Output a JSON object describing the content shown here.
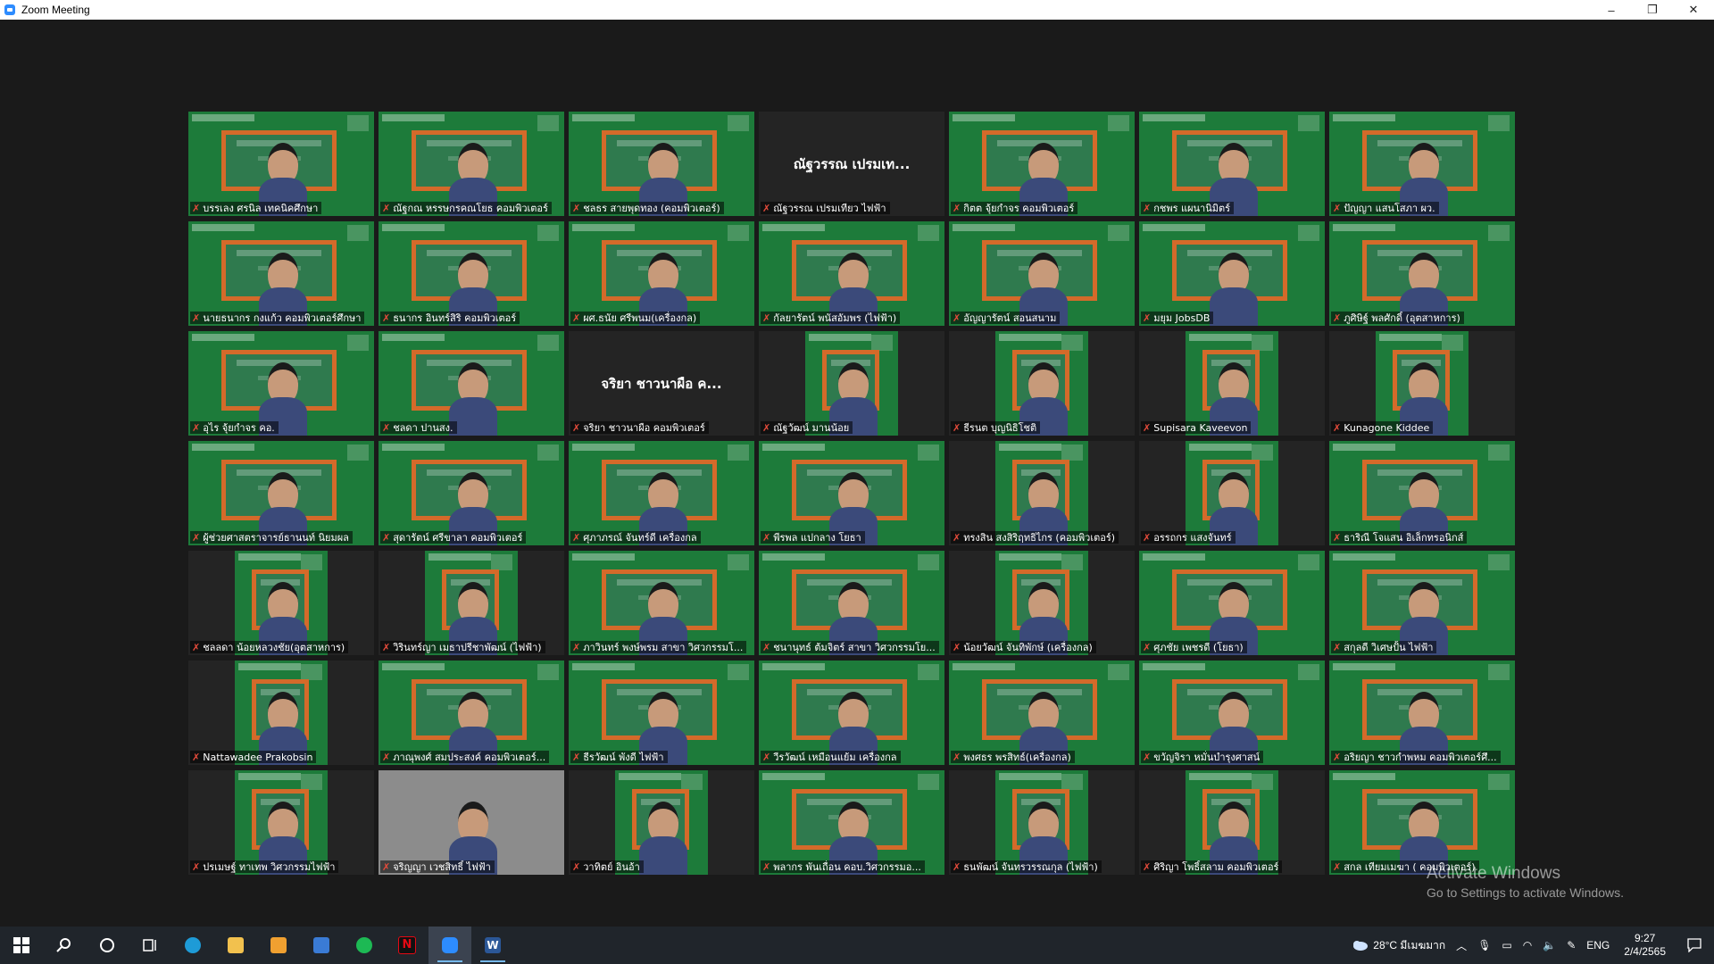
{
  "window": {
    "title": "Zoom Meeting",
    "minimize": "–",
    "restore": "❐",
    "close": "✕"
  },
  "participants": [
    {
      "name": "บรรเลง ศรนิล เทคนิคศึกษา",
      "style": "board",
      "active": true
    },
    {
      "name": "ณัฐกณ หรรษกรคณโยธ คอมพิวเตอร์",
      "style": "board"
    },
    {
      "name": "ชลธร สายพุดทอง (คอมพิวเตอร์)",
      "style": "board"
    },
    {
      "name": "ณัฐวรรณ เปรมเทียว ไฟฟ้า",
      "style": "blank",
      "center_text": "ณัฐวรรณ เปรมเท..."
    },
    {
      "name": "กิตต จุ้ยกำจร คอมพิวเตอร์",
      "style": "board"
    },
    {
      "name": "กชพร แผนานิมิตร์",
      "style": "board"
    },
    {
      "name": "ปัญญา แสนโสภา ผว.",
      "style": "board"
    },
    {
      "name": "นายธนากร กงแก้ว คอมพิวเตอร์ศึกษา",
      "style": "board"
    },
    {
      "name": "ธนากร อินทร์สิริ คอมพิวเตอร์",
      "style": "board"
    },
    {
      "name": "ผศ.ธนัย ศรีพนม(เครื่องกล)",
      "style": "board"
    },
    {
      "name": "กัลยารัตน์ พนัสอัมพร (ไฟฟ้า)",
      "style": "board"
    },
    {
      "name": "อัญญารัตน์ สอนสนาม",
      "style": "board"
    },
    {
      "name": "มยุม JobsDB",
      "style": "board"
    },
    {
      "name": "ภูศิษิฐ์ พลศักดิ์ (อุตสาหการ)",
      "style": "board"
    },
    {
      "name": "อุไร จุ้ยกำจร คอ.",
      "style": "board"
    },
    {
      "name": "ชลดา ปานสง.",
      "style": "board"
    },
    {
      "name": "จริยา ชาวนาผือ คอมพิวเตอร์",
      "style": "blank",
      "center_text": "จริยา ชาวนาผือ ค..."
    },
    {
      "name": "ณัฐวัฒน์ มานน้อย",
      "style": "narrow"
    },
    {
      "name": "ธีรนต บุญนิธิโชติ",
      "style": "narrow"
    },
    {
      "name": "Supisara Kaveevon",
      "style": "narrow"
    },
    {
      "name": "Kunagone Kiddee",
      "style": "narrow"
    },
    {
      "name": "ผู้ช่วยศาสตราจารย์ธานนท์ นิยมผล",
      "style": "board"
    },
    {
      "name": "สุดารัตน์ ศรีขาลา คอมพิวเตอร์",
      "style": "board"
    },
    {
      "name": "ศุภาภรณ์ จันทร์ดี เครื่องกล",
      "style": "board"
    },
    {
      "name": "พีรพล แปกลาง โยธา",
      "style": "board"
    },
    {
      "name": "ทรงสิน สงสิริฤทธิไกร (คอมพิวเตอร์)",
      "style": "narrow"
    },
    {
      "name": "อรรถกร แสงจันทร์",
      "style": "narrow"
    },
    {
      "name": "ธาริณี โจแสน อิเล็กทรอนิกส์",
      "style": "board"
    },
    {
      "name": "ชลลดา น้อยหลวงชัย(อุตสาหการ)",
      "style": "narrow"
    },
    {
      "name": "วิรินทร์ญา เมธาปรีชาพัฒน์ (ไฟฟ้า)",
      "style": "narrow"
    },
    {
      "name": "ภาวินทร์ พงษ์พรม สาขา วิศวกรรมโ...",
      "style": "board"
    },
    {
      "name": "ชนานุทธ์ ต้มจิตร์ สาขา วิศวกรรมโย...",
      "style": "board"
    },
    {
      "name": "น้อยวัฒน์ จันทิพักษ์ (เครื่องกล)",
      "style": "narrow"
    },
    {
      "name": "ศุภชัย เพชรดี (โยธา)",
      "style": "board"
    },
    {
      "name": "สกุลดี วิเศษปั้น ไฟฟ้า",
      "style": "board"
    },
    {
      "name": "Nattawadee Prakobsin",
      "style": "narrow"
    },
    {
      "name": "ภาณุพงศ์ สมประสงค์ คอมพิวเตอร์...",
      "style": "board"
    },
    {
      "name": "ธีรวัฒน์ พังดี ไฟฟ้า",
      "style": "board"
    },
    {
      "name": "วีรวัฒน์ เหมือนแย้ม เครื่องกล",
      "style": "board"
    },
    {
      "name": "พงศธร พรสิทธ์(เครื่องกล)",
      "style": "board"
    },
    {
      "name": "ขวัญจิรา หมั่นบำรุงศาสน์",
      "style": "board"
    },
    {
      "name": "อริยญา ชาวกำพหม คอมพิวเตอร์ศึ...",
      "style": "board"
    },
    {
      "name": "ปรเมษฐ์ ทาเทพ วิศวกรรมไฟฟ้า",
      "style": "narrow"
    },
    {
      "name": "จริญญา เวชสิทธิ์ ไฟฟ้า",
      "style": "camera"
    },
    {
      "name": "วาทิตย์ อินอ้า",
      "style": "narrow"
    },
    {
      "name": "พลากร พันเถื่อน คอบ.วิศวกรรมอ...",
      "style": "board"
    },
    {
      "name": "ธนพัฒน์ จันทรวรรณกุล (ไฟฟ้า)",
      "style": "narrow"
    },
    {
      "name": "ศิริญา โพธิ์สลาม คอมพิวเตอร์",
      "style": "narrow"
    },
    {
      "name": "สกล เทียมเมฆา ( คอมพิวเตอร์)",
      "style": "board"
    }
  ],
  "watermark": {
    "line1": "Activate Windows",
    "line2": "Go to Settings to activate Windows."
  },
  "taskbar": {
    "weather": "28°C มีเมฆมาก",
    "language": "ENG",
    "time": "9:27",
    "date": "2/4/2565"
  },
  "colors": {
    "accent": "#d5e83b",
    "mic_off": "#e64b3b",
    "board_green": "#1d7b3a",
    "board_frame": "#d46a2a"
  }
}
